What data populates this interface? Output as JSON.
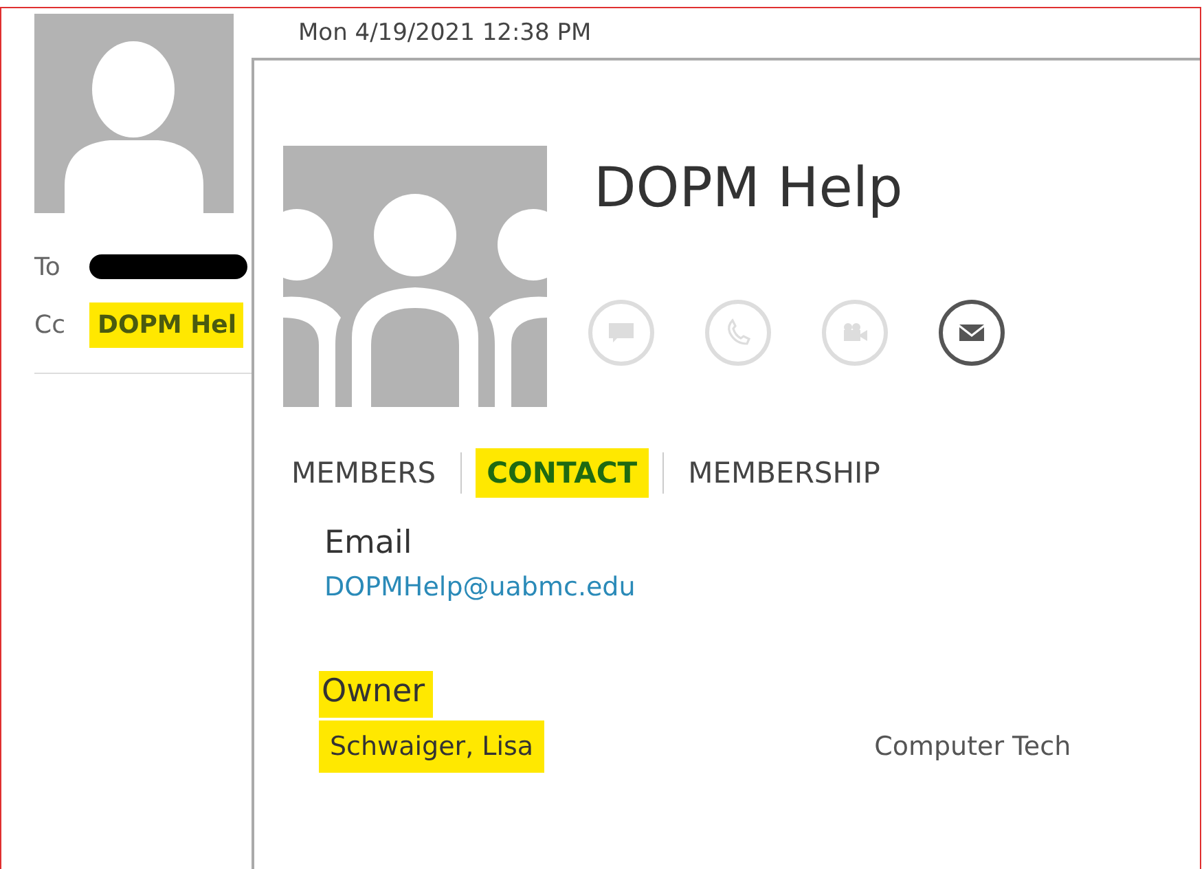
{
  "message": {
    "sent": "Mon 4/19/2021 12:38 PM",
    "recipients": [
      {
        "label": "To",
        "kind": "redacted"
      },
      {
        "label": "Cc",
        "kind": "name",
        "name": "DOPM Hel",
        "highlighted": true
      }
    ]
  },
  "contact_card": {
    "title": "DOPM Help",
    "actions": [
      {
        "kind": "chat",
        "disabled": true
      },
      {
        "kind": "call",
        "disabled": true
      },
      {
        "kind": "video",
        "disabled": true
      },
      {
        "kind": "email",
        "disabled": false
      }
    ],
    "tabs": [
      {
        "label": "MEMBERS",
        "selected": false
      },
      {
        "label": "CONTACT",
        "selected": true
      },
      {
        "label": "MEMBERSHIP",
        "selected": false
      }
    ],
    "email": {
      "label": "Email",
      "value": "DOPMHelp@uabmc.edu"
    },
    "owner": {
      "label": "Owner",
      "label_highlighted": true,
      "name": "Schwaiger, Lisa",
      "name_highlighted": true,
      "title": "Computer Tech"
    }
  }
}
